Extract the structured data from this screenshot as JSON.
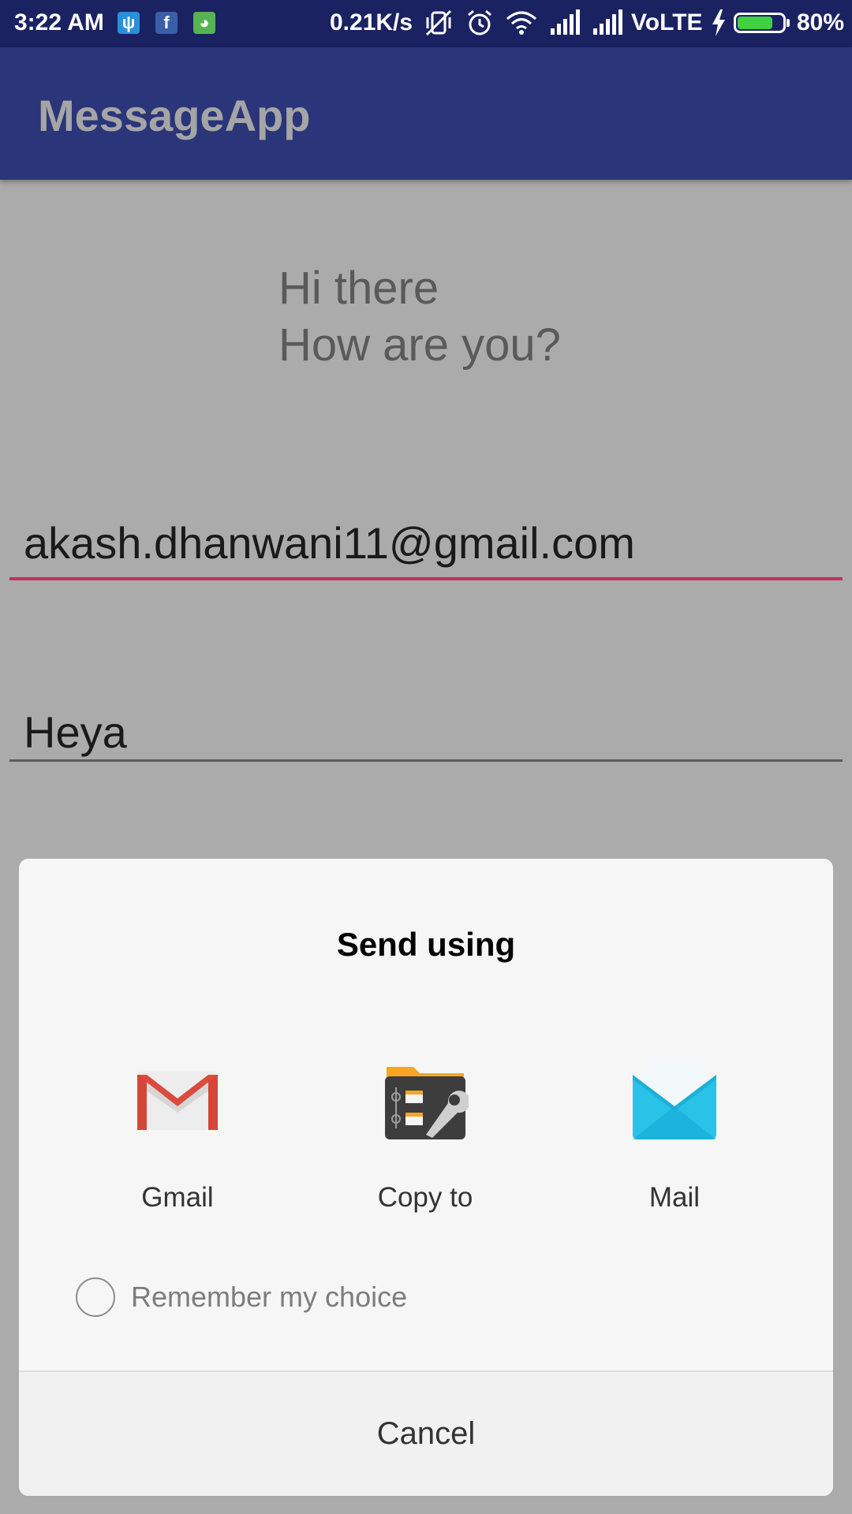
{
  "status_bar": {
    "time": "3:22 AM",
    "network_speed": "0.21K/s",
    "network_type": "VoLTE",
    "battery_percent": "80%",
    "battery_level": 0.8,
    "notification_icons": [
      "usb-icon",
      "facebook-icon",
      "android-bot-icon"
    ],
    "system_icons": [
      "vibrate-off-icon",
      "alarm-icon",
      "wifi-icon",
      "signal-icon",
      "signal-icon",
      "charging-icon",
      "battery-icon"
    ]
  },
  "app_bar": {
    "title": "MessageApp",
    "color": "#2b357a"
  },
  "content": {
    "message_line1": "Hi there",
    "message_line2": "How are you?",
    "email_value": "akash.dhanwani11@gmail.com",
    "subject_value": "Heya",
    "accent_color": "#c2305f"
  },
  "dialog": {
    "title": "Send using",
    "apps": [
      {
        "label": "Gmail",
        "icon": "gmail-icon"
      },
      {
        "label": "Copy to",
        "icon": "file-manager-icon"
      },
      {
        "label": "Mail",
        "icon": "mail-icon"
      }
    ],
    "remember_label": "Remember my choice",
    "remember_checked": false,
    "cancel_label": "Cancel"
  }
}
